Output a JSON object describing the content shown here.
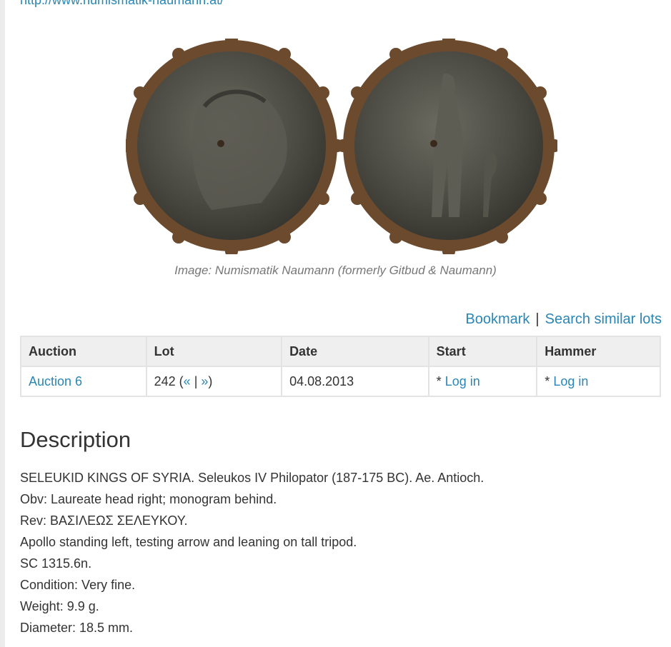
{
  "top_link": "http://www.numismatik-naumann.at/",
  "image_caption": "Image: Numismatik Naumann (formerly Gitbud & Naumann)",
  "actions": {
    "bookmark": "Bookmark",
    "separator": "|",
    "search_similar": "Search similar lots"
  },
  "table": {
    "headers": [
      "Auction",
      "Lot",
      "Date",
      "Start",
      "Hammer"
    ],
    "row": {
      "auction": "Auction 6",
      "lot_number": "242",
      "lot_open": " (",
      "prev": "«",
      "lot_sep": " | ",
      "next": "»",
      "lot_close": ")",
      "date": "04.08.2013",
      "start_prefix": "* ",
      "start_link": "Log in",
      "hammer_prefix": "* ",
      "hammer_link": "Log in"
    }
  },
  "description": {
    "title": "Description",
    "lines": [
      "SELEUKID KINGS OF SYRIA. Seleukos IV Philopator (187-175 BC). Ae. Antioch.",
      "Obv: Laureate head right; monogram behind.",
      "Rev: ΒΑΣΙΛΕΩΣ ΣΕΛΕΥΚΟΥ.",
      "Apollo standing left, testing arrow and leaning on tall tripod.",
      "SC 1315.6n.",
      "Condition: Very fine.",
      "Weight: 9.9 g.",
      "Diameter: 18.5 mm."
    ]
  },
  "colors": {
    "link": "#2a86b5",
    "text": "#333333",
    "caption": "#777777",
    "coin_patina": "#4a4a42",
    "coin_edge": "#6b4a2e"
  }
}
